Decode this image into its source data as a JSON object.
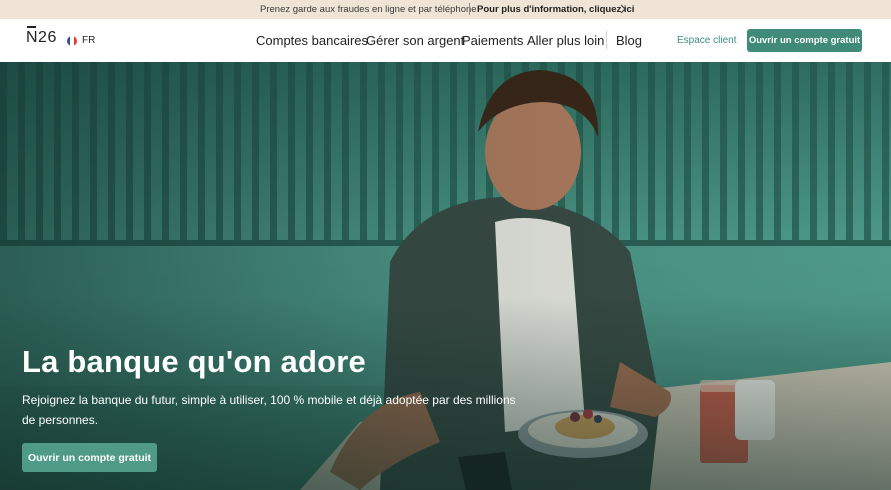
{
  "banner": {
    "message": "Prenez garde aux fraudes en ligne et par téléphone",
    "link": "Pour plus d'information, cliquez ici"
  },
  "nav": {
    "logo": "N26",
    "language": "FR",
    "menu": [
      "Comptes bancaires",
      "Gérer son argent",
      "Paiements",
      "Aller plus loin",
      "Blog"
    ],
    "client_link": "Espace client",
    "cta": "Ouvrir un compte gratuit"
  },
  "hero": {
    "title": "La banque qu'on adore",
    "subtitle": "Rejoignez la banque du futur, simple à utiliser, 100 % mobile et déjà adoptée par des millions de personnes.",
    "cta": "Ouvrir un compte gratuit"
  },
  "colors": {
    "accent": "#3f8a78",
    "banner_bg": "#efe4d6",
    "hero_bg": "#4d9a8a"
  },
  "icons": [
    "chevron-right-icon",
    "france-flag-icon"
  ]
}
